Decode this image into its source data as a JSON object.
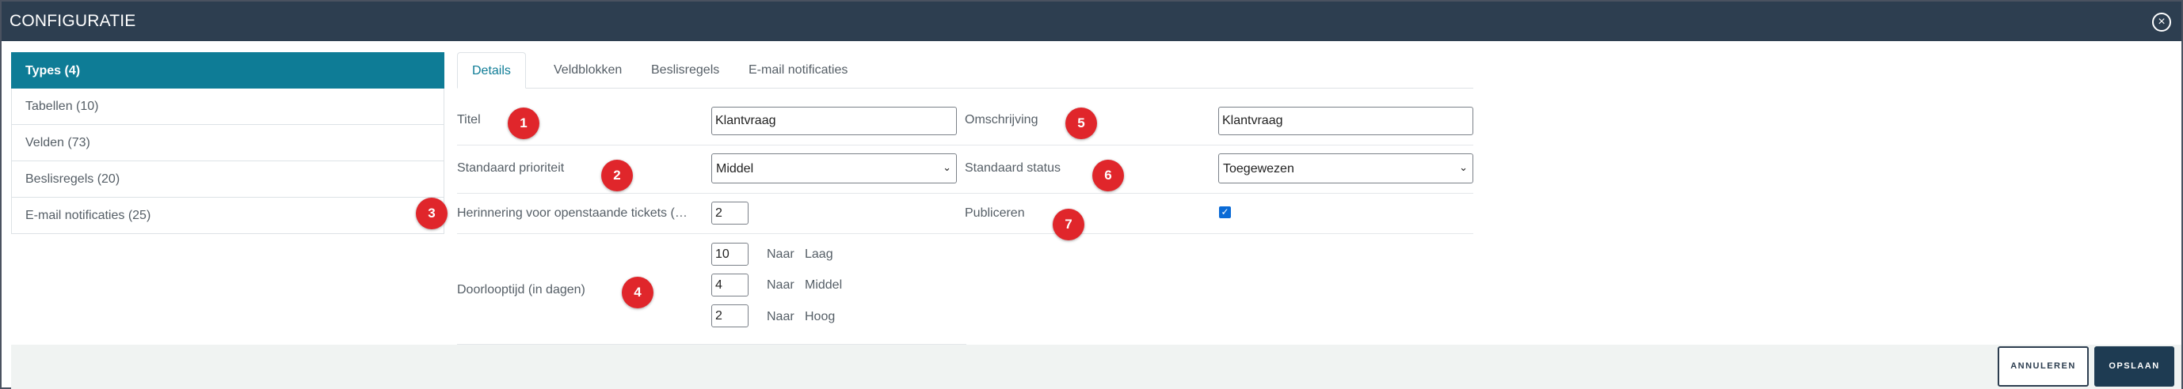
{
  "modal": {
    "title": "CONFIGURATIE",
    "close_label": "×"
  },
  "sidebar": {
    "items": [
      {
        "label": "Types (4)"
      },
      {
        "label": "Tabellen (10)"
      },
      {
        "label": "Velden (73)"
      },
      {
        "label": "Beslisregels (20)"
      },
      {
        "label": "E-mail notificaties (25)"
      }
    ]
  },
  "tabs": [
    "Details",
    "Veldblokken",
    "Beslisregels",
    "E-mail notificaties"
  ],
  "form": {
    "titel": {
      "label": "Titel",
      "value": "Klantvraag"
    },
    "omschrijving": {
      "label": "Omschrijving",
      "value": "Klantvraag"
    },
    "prioriteit": {
      "label": "Standaard prioriteit",
      "value": "Middel"
    },
    "status": {
      "label": "Standaard status",
      "value": "Toegewezen"
    },
    "herinnering": {
      "label": "Herinnering voor openstaande tickets (…",
      "value": "2"
    },
    "publiceren": {
      "label": "Publiceren",
      "checked": true
    },
    "doorlooptijd": {
      "label": "Doorlooptijd (in dagen)",
      "rows": [
        {
          "value": "10",
          "naar": "Naar",
          "level": "Laag"
        },
        {
          "value": "4",
          "naar": "Naar",
          "level": "Middel"
        },
        {
          "value": "2",
          "naar": "Naar",
          "level": "Hoog"
        }
      ]
    }
  },
  "markers": [
    "1",
    "2",
    "3",
    "4",
    "5",
    "6",
    "7"
  ],
  "footer": {
    "cancel_label": "ANNULEREN",
    "save_label": "OPSLAAN"
  },
  "colors": {
    "header": "#2d3e50",
    "accent": "#0e7c96",
    "marker": "#e0262b",
    "save_button": "#1e3b52"
  }
}
